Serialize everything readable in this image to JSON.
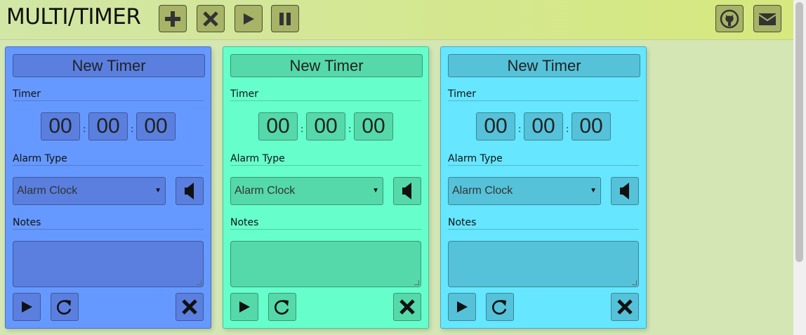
{
  "app": {
    "title": "MULTI/TIMER"
  },
  "toolbar": [
    {
      "name": "add-timer-button",
      "icon": "plus-icon"
    },
    {
      "name": "remove-all-button",
      "icon": "close-icon"
    },
    {
      "name": "start-all-button",
      "icon": "play-icon"
    },
    {
      "name": "pause-all-button",
      "icon": "pause-icon"
    },
    {
      "name": "github-button",
      "icon": "github-icon"
    },
    {
      "name": "mail-button",
      "icon": "mail-icon"
    }
  ],
  "timers": [
    {
      "name": "New Timer",
      "section_timer": "Timer",
      "hours": "00",
      "minutes": "00",
      "seconds": "00",
      "separator": ":",
      "section_alarm": "Alarm Type",
      "alarm": "Alarm Clock",
      "section_notes": "Notes",
      "notes": "",
      "bg": "#6699ff",
      "field": "#5a7fdf"
    },
    {
      "name": "New Timer",
      "section_timer": "Timer",
      "hours": "00",
      "minutes": "00",
      "seconds": "00",
      "separator": ":",
      "section_alarm": "Alarm Type",
      "alarm": "Alarm Clock",
      "section_notes": "Notes",
      "notes": "",
      "bg": "#66ffcc",
      "field": "#55d9aa"
    },
    {
      "name": "New Timer",
      "section_timer": "Timer",
      "hours": "00",
      "minutes": "00",
      "seconds": "00",
      "separator": ":",
      "section_alarm": "Alarm Type",
      "alarm": "Alarm Clock",
      "section_notes": "Notes",
      "notes": "",
      "bg": "#66e6ff",
      "field": "#55c2d9"
    }
  ],
  "colors": {
    "header_start": "#d2e6a6",
    "header_end": "#d6e87e",
    "page_bg": "#d3e6b4",
    "toolbar_button": "#a7b366"
  }
}
